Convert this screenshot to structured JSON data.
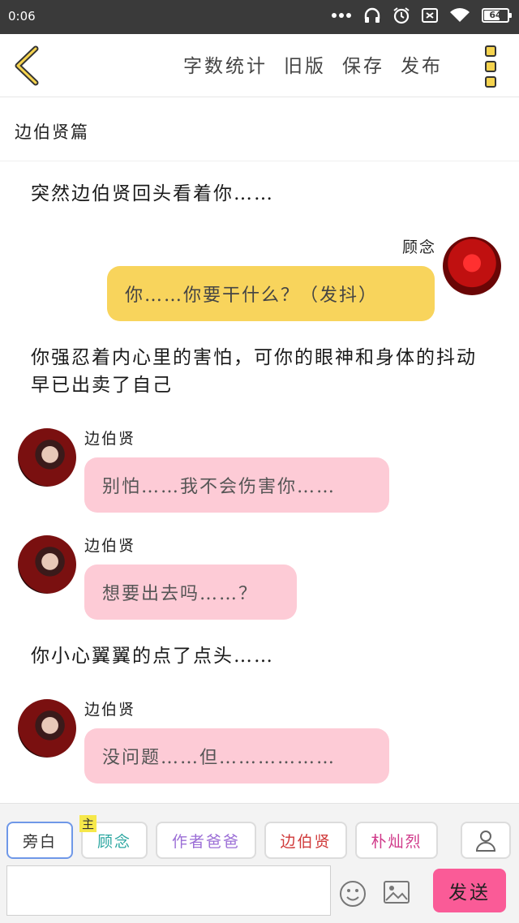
{
  "status_bar": {
    "time": "0:06",
    "battery": "64",
    "icons": [
      "dots-icon",
      "headphones-icon",
      "alarm-icon",
      "sim-icon",
      "wifi-icon",
      "battery-icon"
    ]
  },
  "toolbar": {
    "back_icon": "chevron-left-icon",
    "actions": [
      "字数统计",
      "旧版",
      "保存",
      "发布"
    ],
    "menu_icon": "menu-dots-icon",
    "accent": "#f5d34e"
  },
  "story_title": "边伯贤篇",
  "messages": [
    {
      "kind": "narration",
      "text": "突然边伯贤回头看着你……"
    },
    {
      "kind": "bubble",
      "side": "right",
      "speaker": "顾念",
      "text": "你……你要干什么？（发抖）",
      "color": "#f8d45c"
    },
    {
      "kind": "narration",
      "text": "你强忍着内心里的害怕，可你的眼神和身体的抖动早已出卖了自己"
    },
    {
      "kind": "bubble",
      "side": "left",
      "speaker": "边伯贤",
      "text": "别怕……我不会伤害你……",
      "color": "#fdcbd6"
    },
    {
      "kind": "bubble",
      "side": "left",
      "speaker": "边伯贤",
      "text": "想要出去吗……？",
      "color": "#fdcbd6"
    },
    {
      "kind": "narration",
      "text": "你小心翼翼的点了点头……"
    },
    {
      "kind": "bubble",
      "side": "left",
      "speaker": "边伯贤",
      "text": "没问题……但………………",
      "color": "#fdcbd6"
    }
  ],
  "characters": [
    {
      "label": "旁白",
      "color": "#333333",
      "active": true
    },
    {
      "label": "顾念",
      "color": "#2aa6a0",
      "tag": "主"
    },
    {
      "label": "作者爸爸",
      "color": "#9b6ed6"
    },
    {
      "label": "边伯贤",
      "color": "#d03a3a"
    },
    {
      "label": "朴灿烈",
      "color": "#d03a8a"
    }
  ],
  "input": {
    "value": "",
    "placeholder": ""
  },
  "send_label": "发送",
  "send_color": "#fa5b97"
}
